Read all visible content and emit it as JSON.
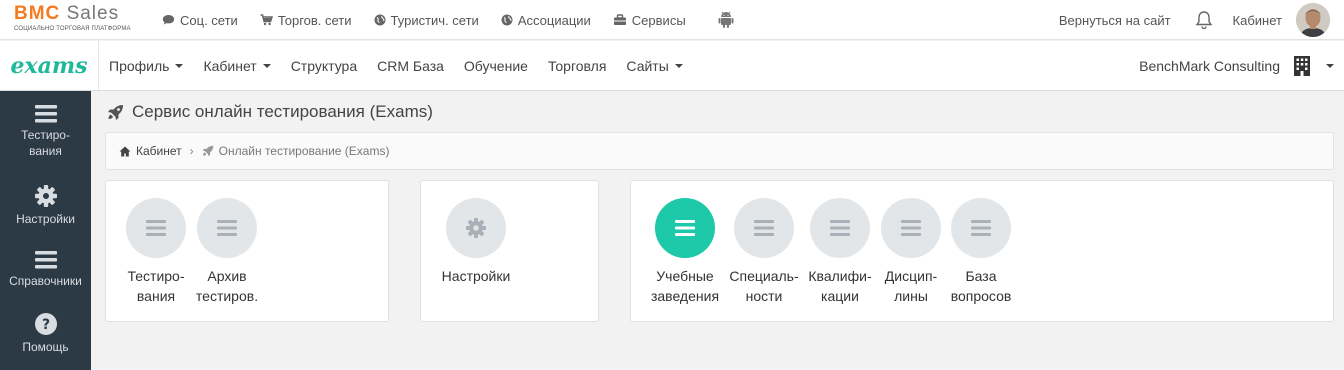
{
  "brand": {
    "name_b": "BMC",
    "name_s": "Sales",
    "tagline": "СОЦИАЛЬНО ТОРГОВАЯ ПЛАТФОРМА"
  },
  "topnav": [
    {
      "label": "Соц. сети",
      "icon": "comment-icon"
    },
    {
      "label": "Торгов. сети",
      "icon": "cart-icon"
    },
    {
      "label": "Туристич. сети",
      "icon": "globe-icon"
    },
    {
      "label": "Ассоциации",
      "icon": "globe-icon"
    },
    {
      "label": "Сервисы",
      "icon": "briefcase-icon"
    }
  ],
  "topright": {
    "back": "Вернуться на сайт",
    "cabinet": "Кабинет"
  },
  "app_logo": "exams",
  "mainnav": [
    {
      "label": "Профиль",
      "dropdown": true
    },
    {
      "label": "Кабинет",
      "dropdown": true
    },
    {
      "label": "Структура",
      "dropdown": false
    },
    {
      "label": "CRM База",
      "dropdown": false
    },
    {
      "label": "Обучение",
      "dropdown": false
    },
    {
      "label": "Торговля",
      "dropdown": false
    },
    {
      "label": "Сайты",
      "dropdown": true
    }
  ],
  "company": "BenchMark Consulting",
  "sidebar": [
    {
      "label": "Тестиро-вания",
      "icon": "list-icon"
    },
    {
      "label": "Настройки",
      "icon": "gear-icon"
    },
    {
      "label": "Справочники",
      "icon": "list-icon"
    },
    {
      "label": "Помощь",
      "icon": "question-icon"
    }
  ],
  "page": {
    "title": "Сервис онлайн тестирования (Exams)",
    "breadcrumb_home": "Кабинет",
    "breadcrumb_current": "Онлайн тестирование (Exams)"
  },
  "cards": [
    {
      "tiles": [
        {
          "line1": "Тестиро-",
          "line2": "вания",
          "icon": "list-icon",
          "active": false
        },
        {
          "line1": "Архив",
          "line2": "тестиров.",
          "icon": "list-icon",
          "active": false
        }
      ]
    },
    {
      "tiles": [
        {
          "line1": "Настройки",
          "line2": "",
          "icon": "gear-icon",
          "active": false
        }
      ]
    },
    {
      "tiles": [
        {
          "line1": "Учебные",
          "line2": "заведения",
          "icon": "list-icon",
          "active": true
        },
        {
          "line1": "Специаль-",
          "line2": "ности",
          "icon": "list-icon",
          "active": false
        },
        {
          "line1": "Квалифи-",
          "line2": "кации",
          "icon": "list-icon",
          "active": false
        },
        {
          "line1": "Дисцип-",
          "line2": "лины",
          "icon": "list-icon",
          "active": false
        },
        {
          "line1": "База",
          "line2": "вопросов",
          "icon": "list-icon",
          "active": false
        }
      ]
    }
  ],
  "colors": {
    "accent": "#1dc9a8",
    "brand_orange": "#f47b20",
    "sidebar_bg": "#2c3a46",
    "tile_bg": "#e3e6e9"
  }
}
